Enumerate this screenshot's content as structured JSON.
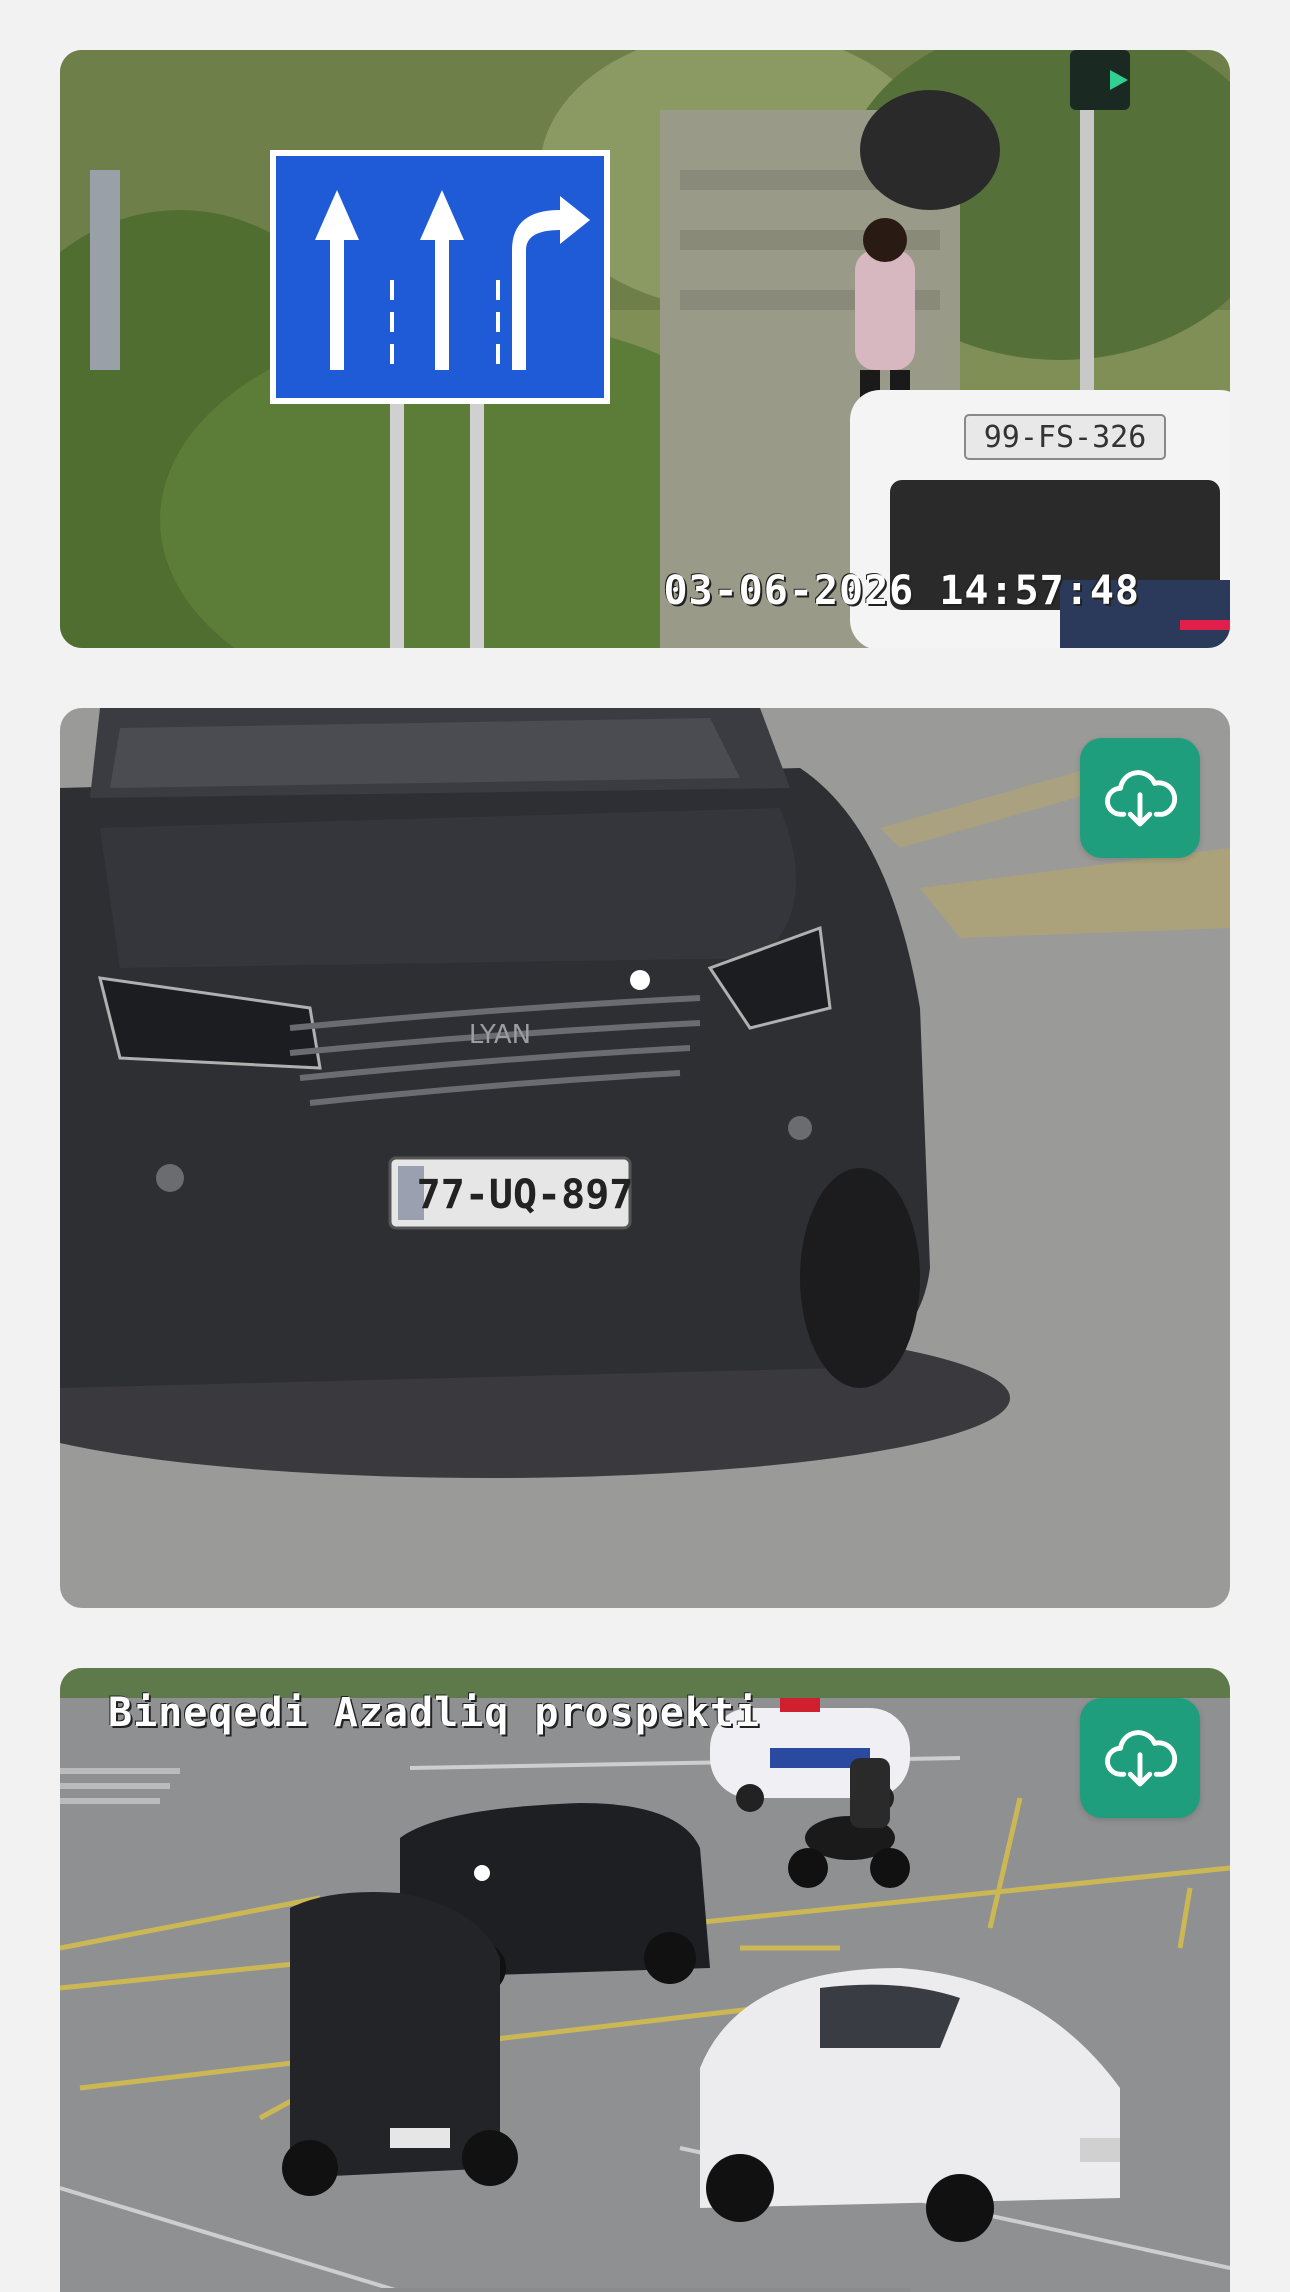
{
  "feed": {
    "photos": [
      {
        "description": "traffic camera frame with lane direction sign",
        "timestamp": "03-06-2026 14:57:48",
        "plate": "99-FS-326"
      },
      {
        "description": "close-up of dark SUV front",
        "plate": "77-UQ-897",
        "download_icon": "cloud-download-icon"
      },
      {
        "description": "intersection overview",
        "location": "Bineqedi Azadliq prospekti",
        "download_icon": "cloud-download-icon"
      }
    ]
  },
  "colors": {
    "background": "#f2f2f2",
    "download_button": "#1e9e7c",
    "sign_blue": "#1f5bd6"
  }
}
